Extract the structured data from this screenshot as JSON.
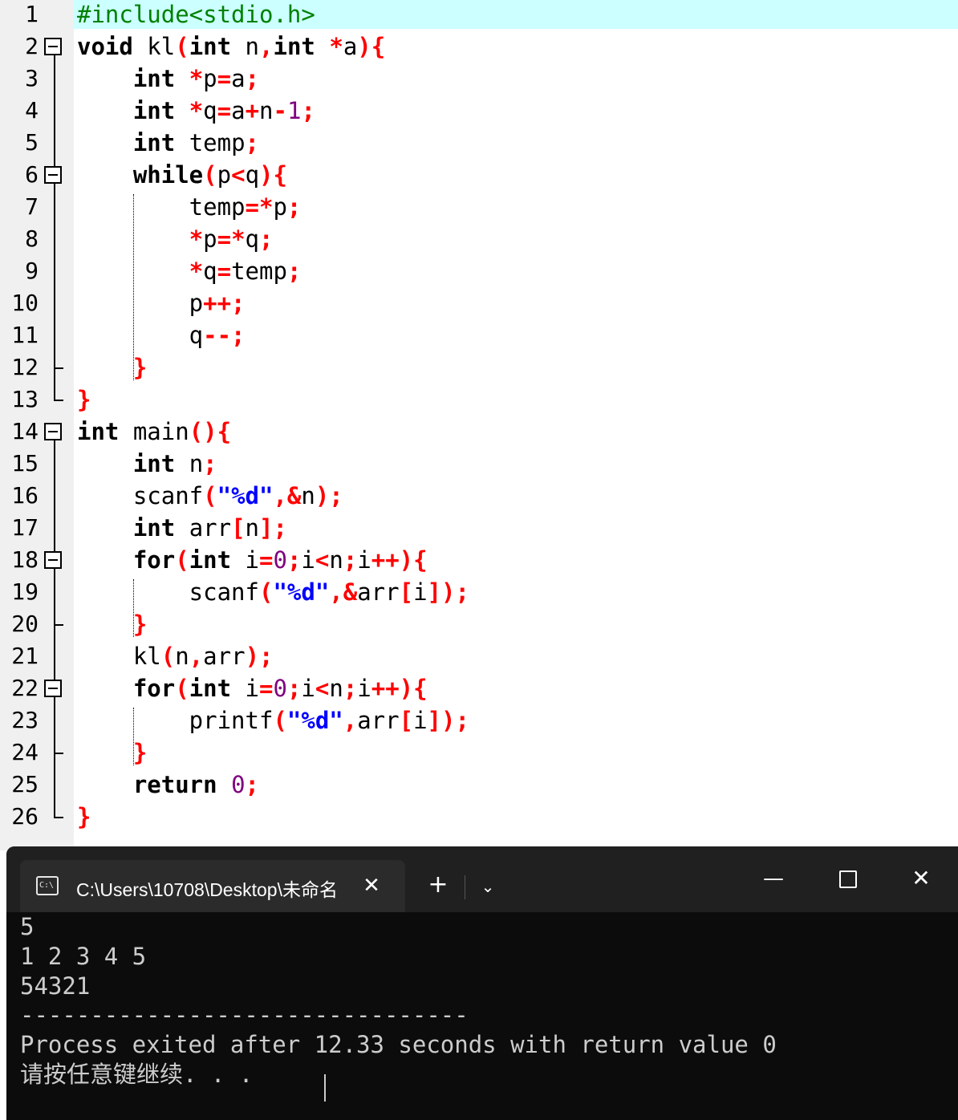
{
  "editor": {
    "line_numbers": [
      "1",
      "2",
      "3",
      "4",
      "5",
      "6",
      "7",
      "8",
      "9",
      "10",
      "11",
      "12",
      "13",
      "14",
      "15",
      "16",
      "17",
      "18",
      "19",
      "20",
      "21",
      "22",
      "23",
      "24",
      "25",
      "26"
    ],
    "highlighted_line": "1",
    "colors": {
      "keyword": "#000000",
      "preprocessor": "#008000",
      "symbol": "#ff0000",
      "number": "#800080",
      "string": "#0000ff",
      "current_line_bg": "#ccffff",
      "gutter_bg": "#f0f0f0"
    },
    "lines": [
      [
        {
          "t": "pp",
          "v": "#include<stdio.h>"
        }
      ],
      [
        {
          "t": "kw",
          "v": "void"
        },
        {
          "t": "id",
          "v": " kl"
        },
        {
          "t": "sym",
          "v": "("
        },
        {
          "t": "kw",
          "v": "int"
        },
        {
          "t": "id",
          "v": " n"
        },
        {
          "t": "sym",
          "v": ","
        },
        {
          "t": "kw",
          "v": "int"
        },
        {
          "t": "id",
          "v": " "
        },
        {
          "t": "sym",
          "v": "*"
        },
        {
          "t": "id",
          "v": "a"
        },
        {
          "t": "sym",
          "v": "){"
        }
      ],
      [
        {
          "t": "id",
          "v": "    "
        },
        {
          "t": "kw",
          "v": "int"
        },
        {
          "t": "id",
          "v": " "
        },
        {
          "t": "sym",
          "v": "*"
        },
        {
          "t": "id",
          "v": "p"
        },
        {
          "t": "sym",
          "v": "="
        },
        {
          "t": "id",
          "v": "a"
        },
        {
          "t": "sym",
          "v": ";"
        }
      ],
      [
        {
          "t": "id",
          "v": "    "
        },
        {
          "t": "kw",
          "v": "int"
        },
        {
          "t": "id",
          "v": " "
        },
        {
          "t": "sym",
          "v": "*"
        },
        {
          "t": "id",
          "v": "q"
        },
        {
          "t": "sym",
          "v": "="
        },
        {
          "t": "id",
          "v": "a"
        },
        {
          "t": "sym",
          "v": "+"
        },
        {
          "t": "id",
          "v": "n"
        },
        {
          "t": "sym",
          "v": "-"
        },
        {
          "t": "num",
          "v": "1"
        },
        {
          "t": "sym",
          "v": ";"
        }
      ],
      [
        {
          "t": "id",
          "v": "    "
        },
        {
          "t": "kw",
          "v": "int"
        },
        {
          "t": "id",
          "v": " temp"
        },
        {
          "t": "sym",
          "v": ";"
        }
      ],
      [
        {
          "t": "id",
          "v": "    "
        },
        {
          "t": "kw",
          "v": "while"
        },
        {
          "t": "sym",
          "v": "("
        },
        {
          "t": "id",
          "v": "p"
        },
        {
          "t": "sym",
          "v": "<"
        },
        {
          "t": "id",
          "v": "q"
        },
        {
          "t": "sym",
          "v": "){"
        }
      ],
      [
        {
          "t": "id",
          "v": "        temp"
        },
        {
          "t": "sym",
          "v": "=*"
        },
        {
          "t": "id",
          "v": "p"
        },
        {
          "t": "sym",
          "v": ";"
        }
      ],
      [
        {
          "t": "id",
          "v": "        "
        },
        {
          "t": "sym",
          "v": "*"
        },
        {
          "t": "id",
          "v": "p"
        },
        {
          "t": "sym",
          "v": "=*"
        },
        {
          "t": "id",
          "v": "q"
        },
        {
          "t": "sym",
          "v": ";"
        }
      ],
      [
        {
          "t": "id",
          "v": "        "
        },
        {
          "t": "sym",
          "v": "*"
        },
        {
          "t": "id",
          "v": "q"
        },
        {
          "t": "sym",
          "v": "="
        },
        {
          "t": "id",
          "v": "temp"
        },
        {
          "t": "sym",
          "v": ";"
        }
      ],
      [
        {
          "t": "id",
          "v": "        p"
        },
        {
          "t": "sym",
          "v": "++;"
        }
      ],
      [
        {
          "t": "id",
          "v": "        q"
        },
        {
          "t": "sym",
          "v": "--;"
        }
      ],
      [
        {
          "t": "id",
          "v": "    "
        },
        {
          "t": "sym",
          "v": "}"
        }
      ],
      [
        {
          "t": "sym",
          "v": "}"
        }
      ],
      [
        {
          "t": "kw",
          "v": "int"
        },
        {
          "t": "id",
          "v": " main"
        },
        {
          "t": "sym",
          "v": "(){"
        }
      ],
      [
        {
          "t": "id",
          "v": "    "
        },
        {
          "t": "kw",
          "v": "int"
        },
        {
          "t": "id",
          "v": " n"
        },
        {
          "t": "sym",
          "v": ";"
        }
      ],
      [
        {
          "t": "id",
          "v": "    scanf"
        },
        {
          "t": "sym",
          "v": "("
        },
        {
          "t": "str",
          "v": "\"%d\""
        },
        {
          "t": "sym",
          "v": ",&"
        },
        {
          "t": "id",
          "v": "n"
        },
        {
          "t": "sym",
          "v": ");"
        }
      ],
      [
        {
          "t": "id",
          "v": "    "
        },
        {
          "t": "kw",
          "v": "int"
        },
        {
          "t": "id",
          "v": " arr"
        },
        {
          "t": "sym",
          "v": "["
        },
        {
          "t": "id",
          "v": "n"
        },
        {
          "t": "sym",
          "v": "];"
        }
      ],
      [
        {
          "t": "id",
          "v": "    "
        },
        {
          "t": "kw",
          "v": "for"
        },
        {
          "t": "sym",
          "v": "("
        },
        {
          "t": "kw",
          "v": "int"
        },
        {
          "t": "id",
          "v": " i"
        },
        {
          "t": "sym",
          "v": "="
        },
        {
          "t": "num",
          "v": "0"
        },
        {
          "t": "sym",
          "v": ";"
        },
        {
          "t": "id",
          "v": "i"
        },
        {
          "t": "sym",
          "v": "<"
        },
        {
          "t": "id",
          "v": "n"
        },
        {
          "t": "sym",
          "v": ";"
        },
        {
          "t": "id",
          "v": "i"
        },
        {
          "t": "sym",
          "v": "++){"
        }
      ],
      [
        {
          "t": "id",
          "v": "        scanf"
        },
        {
          "t": "sym",
          "v": "("
        },
        {
          "t": "str",
          "v": "\"%d\""
        },
        {
          "t": "sym",
          "v": ",&"
        },
        {
          "t": "id",
          "v": "arr"
        },
        {
          "t": "sym",
          "v": "["
        },
        {
          "t": "id",
          "v": "i"
        },
        {
          "t": "sym",
          "v": "]);"
        }
      ],
      [
        {
          "t": "id",
          "v": "    "
        },
        {
          "t": "sym",
          "v": "}"
        }
      ],
      [
        {
          "t": "id",
          "v": "    kl"
        },
        {
          "t": "sym",
          "v": "("
        },
        {
          "t": "id",
          "v": "n"
        },
        {
          "t": "sym",
          "v": ","
        },
        {
          "t": "id",
          "v": "arr"
        },
        {
          "t": "sym",
          "v": ");"
        }
      ],
      [
        {
          "t": "id",
          "v": "    "
        },
        {
          "t": "kw",
          "v": "for"
        },
        {
          "t": "sym",
          "v": "("
        },
        {
          "t": "kw",
          "v": "int"
        },
        {
          "t": "id",
          "v": " i"
        },
        {
          "t": "sym",
          "v": "="
        },
        {
          "t": "num",
          "v": "0"
        },
        {
          "t": "sym",
          "v": ";"
        },
        {
          "t": "id",
          "v": "i"
        },
        {
          "t": "sym",
          "v": "<"
        },
        {
          "t": "id",
          "v": "n"
        },
        {
          "t": "sym",
          "v": ";"
        },
        {
          "t": "id",
          "v": "i"
        },
        {
          "t": "sym",
          "v": "++){"
        }
      ],
      [
        {
          "t": "id",
          "v": "        printf"
        },
        {
          "t": "sym",
          "v": "("
        },
        {
          "t": "str",
          "v": "\"%d\""
        },
        {
          "t": "sym",
          "v": ","
        },
        {
          "t": "id",
          "v": "arr"
        },
        {
          "t": "sym",
          "v": "["
        },
        {
          "t": "id",
          "v": "i"
        },
        {
          "t": "sym",
          "v": "]);"
        }
      ],
      [
        {
          "t": "id",
          "v": "    "
        },
        {
          "t": "sym",
          "v": "}"
        }
      ],
      [
        {
          "t": "id",
          "v": "    "
        },
        {
          "t": "kw",
          "v": "return"
        },
        {
          "t": "id",
          "v": " "
        },
        {
          "t": "num",
          "v": "0"
        },
        {
          "t": "sym",
          "v": ";"
        }
      ],
      [
        {
          "t": "sym",
          "v": "}"
        }
      ]
    ]
  },
  "console": {
    "tab_title": "C:\\Users\\10708\\Desktop\\未命名",
    "tab_icon": "console-icon",
    "close_tab": "✕",
    "new_tab": "+",
    "dropdown": "⌄",
    "minimize": "—",
    "close_window": "✕",
    "output": [
      "5",
      "1 2 3 4 5",
      "54321",
      "--------------------------------",
      "Process exited after 12.33 seconds with return value 0",
      "请按任意键继续. . ."
    ]
  }
}
